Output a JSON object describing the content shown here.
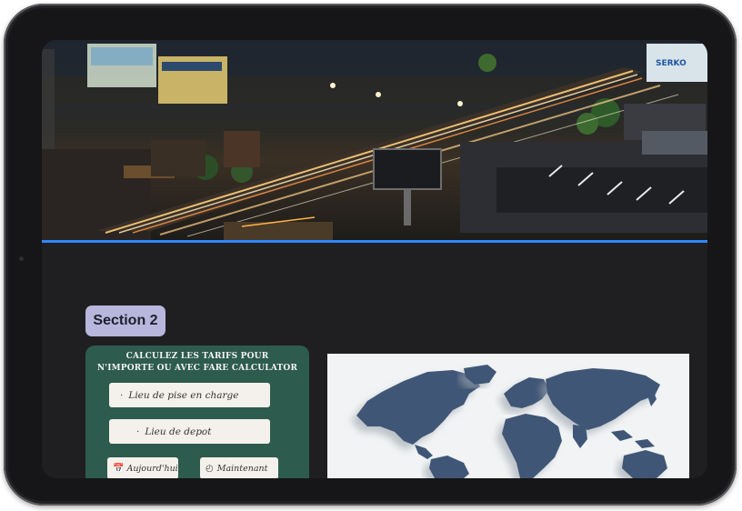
{
  "hero": {
    "billboards": [
      "SERKO"
    ]
  },
  "section": {
    "badge_label": "Section 2"
  },
  "calculator": {
    "title_line1": "CALCULEZ LES TARIFS POUR",
    "title_line2": "N'IMPORTE OU AVEC FARE CALCULATOR",
    "pickup_placeholder": "Lieu de pise en charge",
    "depart_placeholder": "Lieu de depot",
    "today_label": "Aujourd'hui",
    "now_label": "Maintenant",
    "icons": {
      "today": "calendar-icon",
      "now": "clock-icon"
    }
  },
  "map": {
    "colors": {
      "land": "#3f5676",
      "background": "#f1f3f4"
    }
  },
  "colors": {
    "hero_border": "#2f86ff",
    "card": "#2d5b4d",
    "badge": "#b9b6de",
    "screen_bg": "#1f1f21"
  }
}
